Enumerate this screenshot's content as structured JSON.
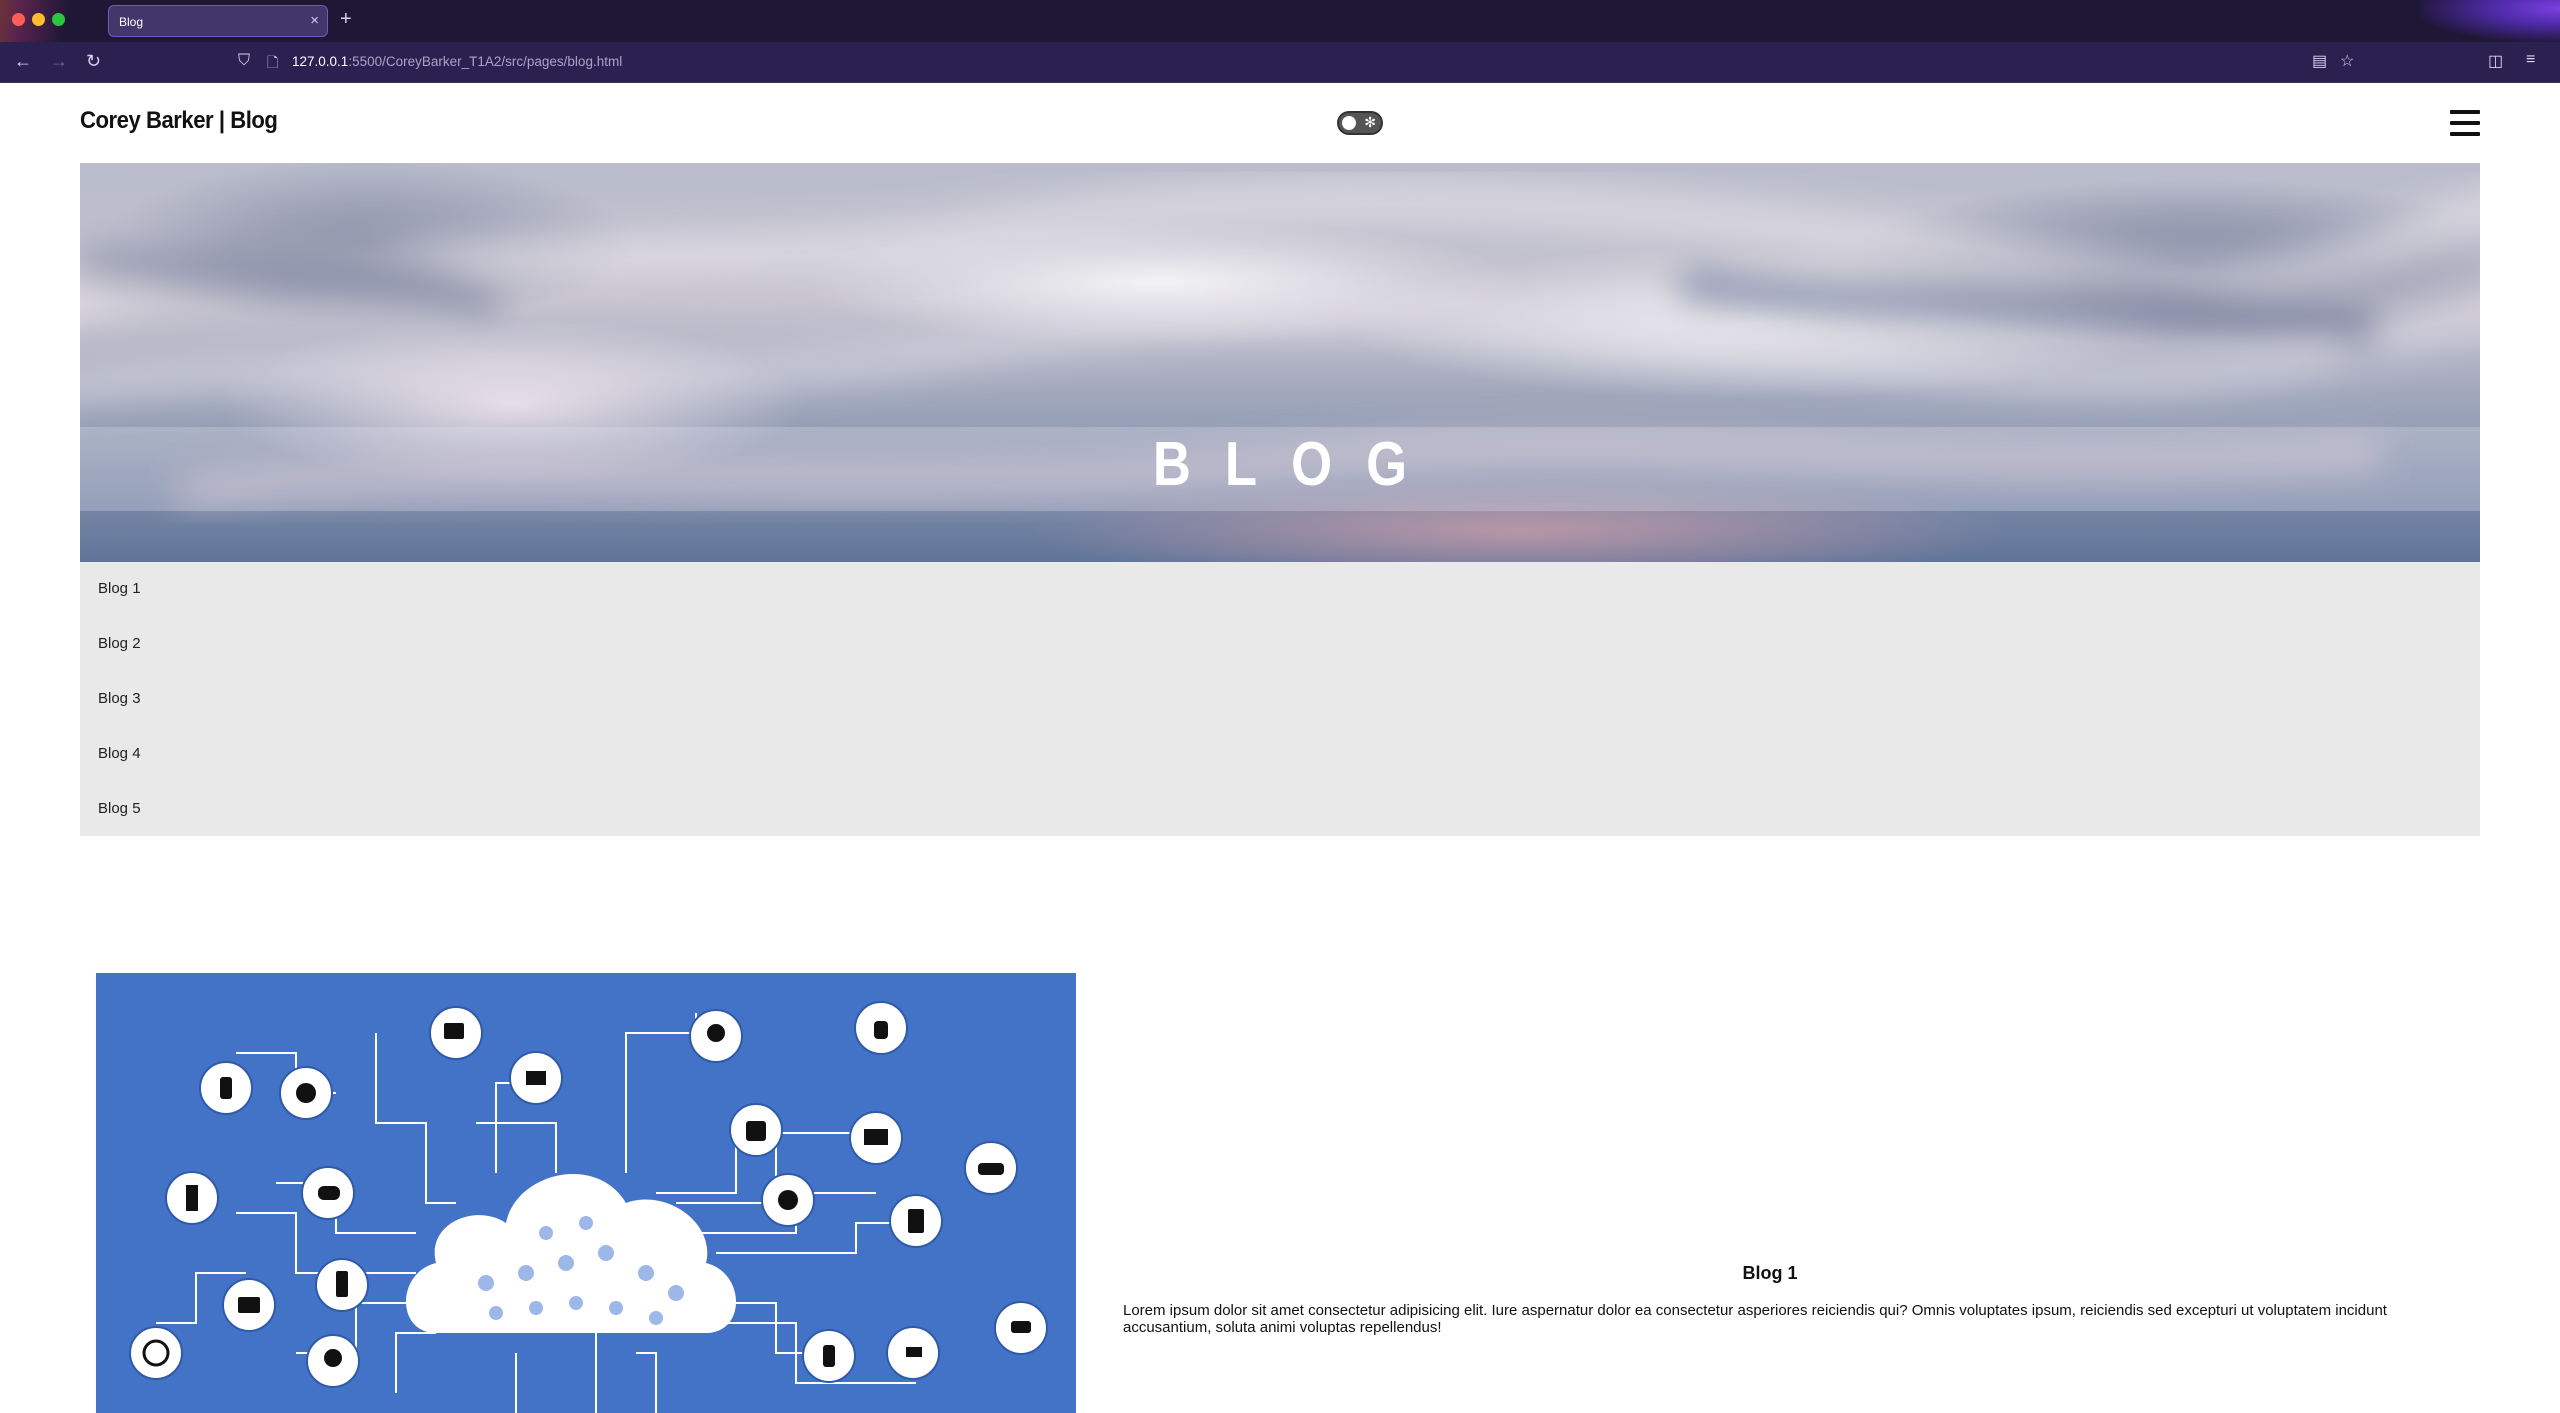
{
  "browser": {
    "tab_title": "Blog",
    "tab_close": "×",
    "new_tab": "+",
    "url_host": "127.0.0.1",
    "url_rest": ":5500/CoreyBarker_T1A2/src/pages/blog.html",
    "icons": {
      "back": "←",
      "forward": "→",
      "reload": "↻",
      "shield": "⛉",
      "page": "🗋",
      "reader": "▤",
      "star": "☆",
      "pocket": "◫",
      "menu": "≡"
    }
  },
  "site": {
    "title": "Corey Barker | Blog",
    "theme_toggle_icon": "✻"
  },
  "hero": {
    "title": "BLOG"
  },
  "blog_nav": {
    "items": [
      "Blog 1",
      "Blog 2",
      "Blog 3",
      "Blog 4",
      "Blog 5"
    ]
  },
  "post": {
    "title": "Blog 1",
    "body": "Lorem ipsum dolor sit amet consectetur adipisicing elit. Iure aspernatur dolor ea consectetur asperiores reiciendis qui? Omnis voluptates ipsum, reiciendis sed excepturi ut voluptatem incidunt accusantium, soluta animi voluptas repellendus!"
  },
  "colors": {
    "chrome_titlebar": "#1f1736",
    "chrome_navbar": "#2b2150",
    "post_image_bg": "#4373c6",
    "blog_nav_bg": "#e9e9e9"
  }
}
